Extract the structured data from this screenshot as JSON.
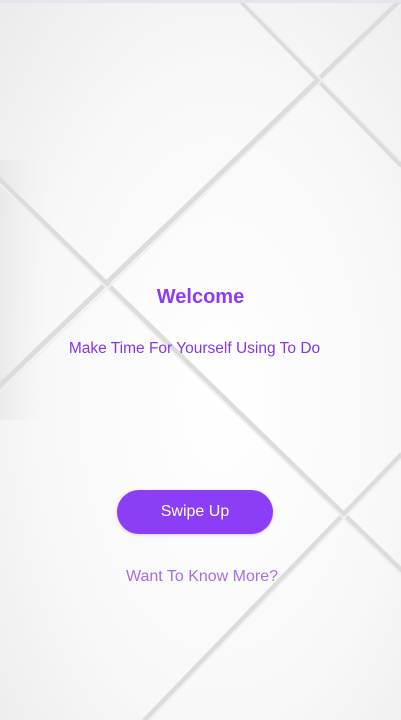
{
  "welcome": {
    "title": "Welcome",
    "subtitle": "Make Time For Yourself Using To Do"
  },
  "actions": {
    "swipe_label": "Swipe Up",
    "more_label": "Want To Know More?"
  },
  "colors": {
    "accent": "#8c3ef6",
    "title": "#8e3cf4",
    "link": "#a56cf2",
    "background": "#f7f7f7"
  }
}
